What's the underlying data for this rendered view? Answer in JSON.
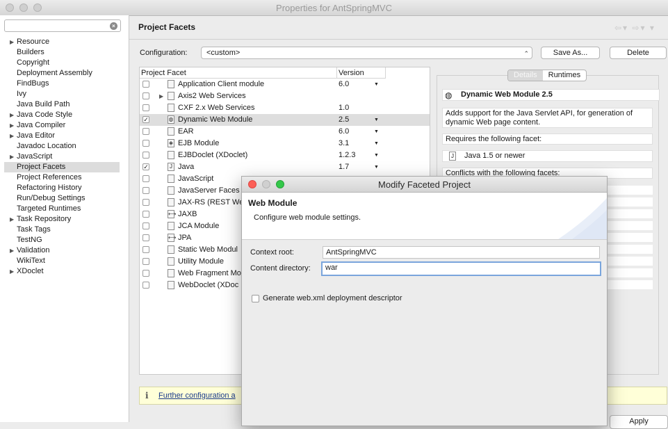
{
  "window": {
    "title": "Properties for AntSpringMVC"
  },
  "sidebar": {
    "search": {
      "value": "",
      "placeholder": ""
    },
    "items": [
      {
        "label": "Resource",
        "expandable": true
      },
      {
        "label": "Builders",
        "expandable": false
      },
      {
        "label": "Copyright",
        "expandable": false
      },
      {
        "label": "Deployment Assembly",
        "expandable": false
      },
      {
        "label": "FindBugs",
        "expandable": false
      },
      {
        "label": "Ivy",
        "expandable": false
      },
      {
        "label": "Java Build Path",
        "expandable": false
      },
      {
        "label": "Java Code Style",
        "expandable": true
      },
      {
        "label": "Java Compiler",
        "expandable": true
      },
      {
        "label": "Java Editor",
        "expandable": true
      },
      {
        "label": "Javadoc Location",
        "expandable": false
      },
      {
        "label": "JavaScript",
        "expandable": true
      },
      {
        "label": "Project Facets",
        "expandable": false,
        "selected": true
      },
      {
        "label": "Project References",
        "expandable": false
      },
      {
        "label": "Refactoring History",
        "expandable": false
      },
      {
        "label": "Run/Debug Settings",
        "expandable": false
      },
      {
        "label": "Targeted Runtimes",
        "expandable": false
      },
      {
        "label": "Task Repository",
        "expandable": true
      },
      {
        "label": "Task Tags",
        "expandable": false
      },
      {
        "label": "TestNG",
        "expandable": false
      },
      {
        "label": "Validation",
        "expandable": true
      },
      {
        "label": "WikiText",
        "expandable": false
      },
      {
        "label": "XDoclet",
        "expandable": true
      }
    ]
  },
  "page": {
    "title": "Project Facets",
    "configuration_label": "Configuration:",
    "configuration_value": "<custom>",
    "save_as_label": "Save As...",
    "delete_label": "Delete",
    "apply_label": "Apply"
  },
  "facets": {
    "columns": {
      "facet": "Project Facet",
      "version": "Version"
    },
    "rows": [
      {
        "name": "Application Client module",
        "version": "6.0",
        "checked": false,
        "dropdown": true,
        "icon": "document-icon"
      },
      {
        "name": "Axis2 Web Services",
        "version": "",
        "checked": false,
        "dropdown": false,
        "icon": "document-icon",
        "expandable": true
      },
      {
        "name": "CXF 2.x Web Services",
        "version": "1.0",
        "checked": false,
        "dropdown": false,
        "icon": "document-icon"
      },
      {
        "name": "Dynamic Web Module",
        "version": "2.5",
        "checked": true,
        "dropdown": true,
        "icon": "globe-icon",
        "selected": true
      },
      {
        "name": "EAR",
        "version": "6.0",
        "checked": false,
        "dropdown": true,
        "icon": "document-icon"
      },
      {
        "name": "EJB Module",
        "version": "3.1",
        "checked": false,
        "dropdown": true,
        "icon": "bean-icon"
      },
      {
        "name": "EJBDoclet (XDoclet)",
        "version": "1.2.3",
        "checked": false,
        "dropdown": true,
        "icon": "document-icon"
      },
      {
        "name": "Java",
        "version": "1.7",
        "checked": true,
        "dropdown": true,
        "icon": "java-icon"
      },
      {
        "name": "JavaScript",
        "version": "",
        "checked": false,
        "dropdown": false,
        "icon": "document-icon"
      },
      {
        "name": "JavaServer Faces",
        "version": "",
        "checked": false,
        "dropdown": false,
        "icon": "document-icon"
      },
      {
        "name": "JAX-RS (REST We",
        "version": "",
        "checked": false,
        "dropdown": false,
        "icon": "document-icon"
      },
      {
        "name": "JAXB",
        "version": "",
        "checked": false,
        "dropdown": false,
        "icon": "jaxb-icon"
      },
      {
        "name": "JCA Module",
        "version": "",
        "checked": false,
        "dropdown": false,
        "icon": "document-icon"
      },
      {
        "name": "JPA",
        "version": "",
        "checked": false,
        "dropdown": false,
        "icon": "jpa-icon"
      },
      {
        "name": "Static Web Modul",
        "version": "",
        "checked": false,
        "dropdown": false,
        "icon": "document-icon"
      },
      {
        "name": "Utility Module",
        "version": "",
        "checked": false,
        "dropdown": false,
        "icon": "document-icon"
      },
      {
        "name": "Web Fragment Mo",
        "version": "",
        "checked": false,
        "dropdown": false,
        "icon": "document-icon"
      },
      {
        "name": "WebDoclet (XDoc",
        "version": "",
        "checked": false,
        "dropdown": false,
        "icon": "document-icon"
      }
    ]
  },
  "details": {
    "tabs": [
      "Details",
      "Runtimes"
    ],
    "active_tab": 0,
    "heading": "Dynamic Web Module 2.5",
    "description": "Adds support for the Java Servlet API, for generation of dynamic Web page content.",
    "requires_label": "Requires the following facet:",
    "requires_item": "Java 1.5 or newer",
    "conflicts_label": "Conflicts with the following facets:"
  },
  "infobar": {
    "icon": "i",
    "link": "Further configuration a"
  },
  "dialog": {
    "title": "Modify Faceted Project",
    "heading": "Web Module",
    "description": "Configure web module settings.",
    "context_root_label": "Context root:",
    "context_root_value": "AntSpringMVC",
    "content_dir_label": "Content directory:",
    "content_dir_value": "war",
    "generate_label": "Generate web.xml deployment descriptor",
    "generate_checked": false
  },
  "colors": {
    "accent_focus": "#7aa5dc",
    "info_bg": "#ffffd8",
    "link": "#1a3a8a",
    "close": "#fc5f57",
    "minimize": "#fdbc2e",
    "zoom": "#34c84a"
  }
}
